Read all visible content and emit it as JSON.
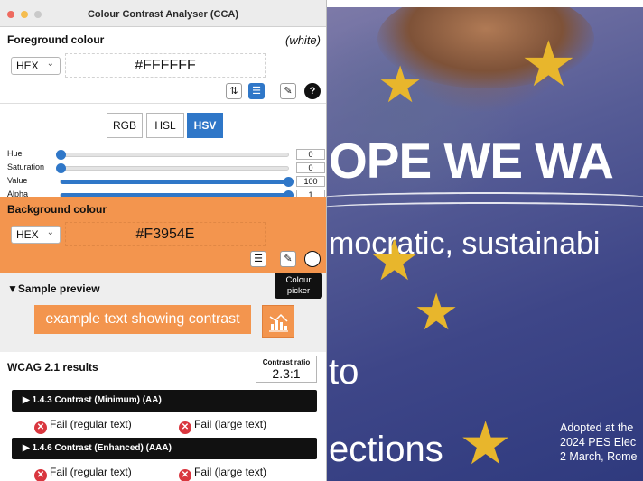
{
  "window": {
    "title": "Colour Contrast Analyser (CCA)",
    "traffic_lights": [
      "#ee6a5f",
      "#f5bd4f",
      "#c9c9c9"
    ]
  },
  "foreground": {
    "title": "Foreground colour",
    "name": "(white)",
    "format": "HEX",
    "value": "#FFFFFF",
    "tools": [
      "swap-icon",
      "sliders-icon",
      "eyedropper-icon",
      "help-icon"
    ]
  },
  "modes": {
    "items": [
      "RGB",
      "HSL",
      "HSV"
    ],
    "active": "HSV"
  },
  "sliders": [
    {
      "label": "Hue",
      "value": "0",
      "fraction": 0
    },
    {
      "label": "Saturation",
      "value": "0",
      "fraction": 0
    },
    {
      "label": "Value",
      "value": "100",
      "fraction": 1
    },
    {
      "label": "Alpha",
      "value": "1",
      "fraction": 1
    }
  ],
  "background": {
    "title": "Background colour",
    "format": "HEX",
    "value": "#F3954E",
    "color": "#f3954e"
  },
  "preview": {
    "title": "▼Sample preview",
    "tooltip_line1": "Colour",
    "tooltip_line2": "picker",
    "sample_text": "example text showing contrast"
  },
  "wcag": {
    "title": "WCAG 2.1 results",
    "ratio_label": "Contrast ratio",
    "ratio_value": "2.3:1",
    "criteria": [
      {
        "label": "▶ 1.4.3 Contrast (Minimum) (AA)",
        "regular": "Fail (regular text)",
        "large": "Fail (large text)"
      },
      {
        "label": "▶ 1.4.6 Contrast (Enhanced) (AAA)",
        "regular": "Fail (regular text)",
        "large": "Fail (large text)"
      }
    ]
  },
  "backdrop": {
    "headline": "OPE WE WA",
    "subline": "mocratic, sustainabi",
    "word_to": "to",
    "word_ections": "ections",
    "adopted_1": "Adopted at the",
    "adopted_2": "2024 PES Elec",
    "adopted_3": "2 March, Rome"
  },
  "colors": {
    "accent": "#2f77c8",
    "fail": "#d9363e",
    "flag_blue": "#3e4688",
    "star": "#e8b62c"
  }
}
